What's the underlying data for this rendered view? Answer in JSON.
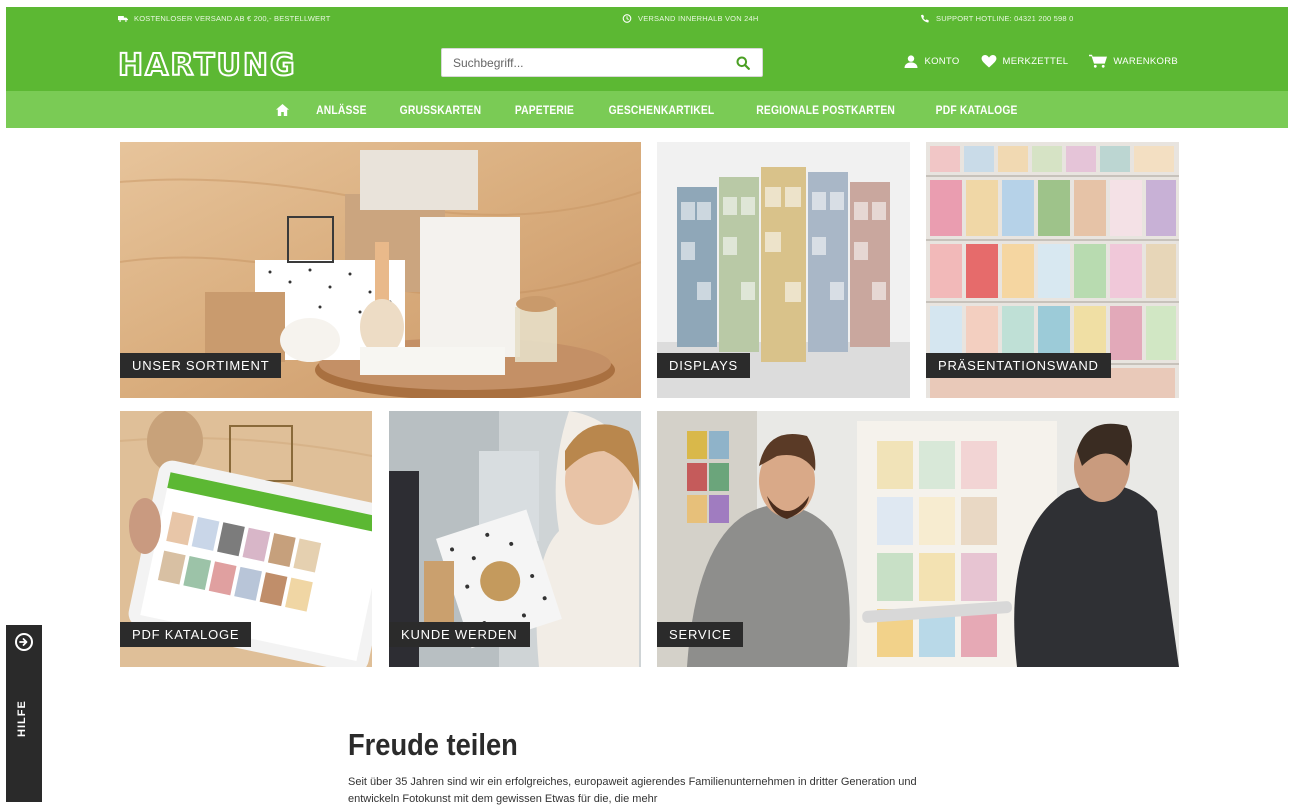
{
  "topbar": {
    "shipping_note": "KOSTENLOSER VERSAND AB € 200,- BESTELLWERT",
    "delivery_note": "VERSAND INNERHALB VON 24H",
    "hotline_note": "SUPPORT HOTLINE: 04321 200 598 0"
  },
  "header": {
    "logo_text": "HARTUNG",
    "search_placeholder": "Suchbegriff...",
    "account_label": "KONTO",
    "wishlist_label": "MERKZETTEL",
    "cart_label": "WARENKORB"
  },
  "nav": {
    "items": [
      "ANLÄSSE",
      "GRUSSKARTEN",
      "PAPETERIE",
      "GESCHENKARTIKEL",
      "REGIONALE POSTKARTEN",
      "PDF KATALOGE"
    ]
  },
  "tiles": {
    "sortiment": "UNSER SORTIMENT",
    "displays": "DISPLAYS",
    "wand": "PRÄSENTATIONSWAND",
    "pdf": "PDF KATALOGE",
    "kunde": "KUNDE WERDEN",
    "service": "SERVICE"
  },
  "help": {
    "label": "HILFE"
  },
  "intro": {
    "title": "Freude teilen",
    "text": "Seit über 35 Jahren sind wir ein erfolgreiches, europaweit agierendes Familienunternehmen in dritter Generation und entwickeln Fotokunst mit dem gewissen Etwas für die, die mehr"
  },
  "colors": {
    "brand_green": "#5cb833",
    "nav_green": "#7acb55",
    "caption_bg": "#2b2b2b"
  }
}
